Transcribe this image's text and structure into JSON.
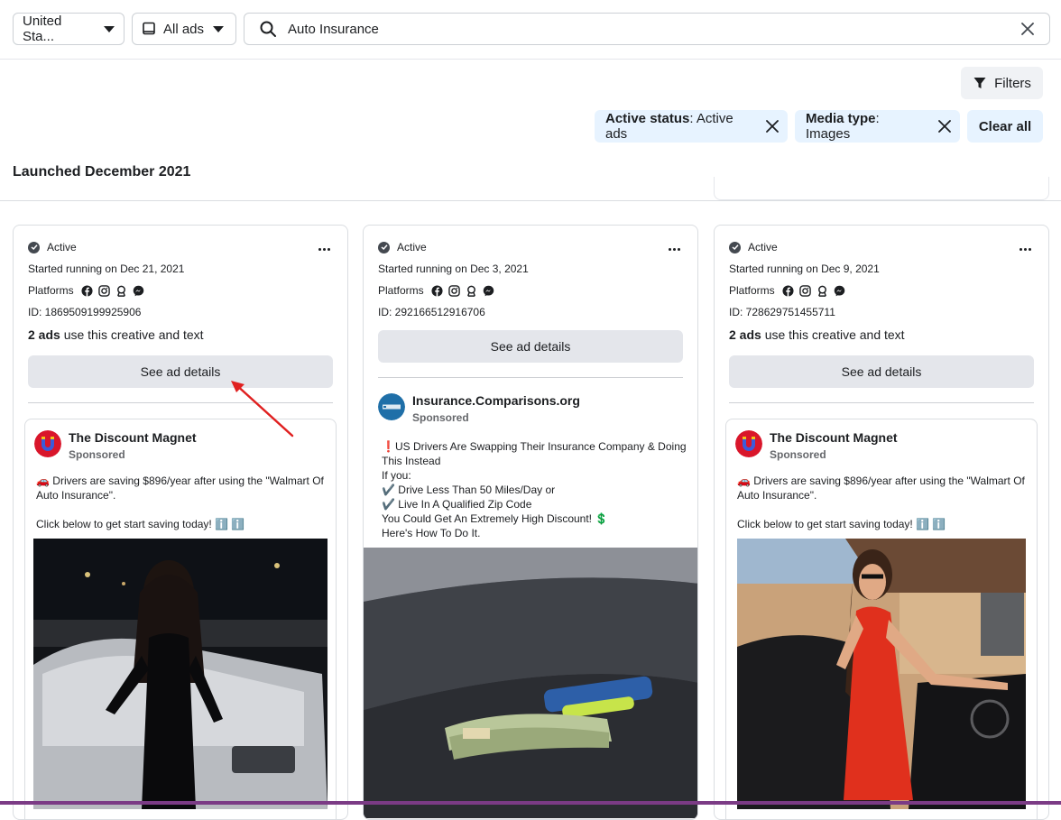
{
  "search_bar": {
    "country": "United Sta...",
    "ad_type": "All ads",
    "query": "Auto Insurance"
  },
  "filters_button": "Filters",
  "chips": [
    {
      "key": "Active status",
      "value": ": Active ads"
    },
    {
      "key": "Media type",
      "value": ": Images"
    }
  ],
  "clear_all": "Clear all",
  "section_title": "Launched December 2021",
  "cards": [
    {
      "status": "Active",
      "started": "Started running on Dec 21, 2021",
      "platforms_label": "Platforms",
      "id": "ID: 1869509199925906",
      "ads_count_bold": "2 ads",
      "ads_count_rest": " use this creative and text",
      "see_details": "See ad details",
      "advertiser": "The Discount Magnet",
      "sponsored": "Sponsored",
      "body": "🚗 Drivers are saving $896/year after using the \"Walmart Of Auto Insurance\".\n\nClick below to get start saving today! ℹ️ ℹ️"
    },
    {
      "status": "Active",
      "started": "Started running on Dec 3, 2021",
      "platforms_label": "Platforms",
      "id": "ID: 292166512916706",
      "see_details": "See ad details",
      "advertiser": "Insurance.Comparisons.org",
      "sponsored": "Sponsored",
      "body": "❗US Drivers Are Swapping Their Insurance Company & Doing This Instead\nIf you:\n✔️ Drive Less Than 50 Miles/Day or\n✔️ Live In A Qualified Zip Code\nYou Could Get An Extremely High Discount! 💲\nHere's How To Do It."
    },
    {
      "status": "Active",
      "started": "Started running on Dec 9, 2021",
      "platforms_label": "Platforms",
      "id": "ID: 728629751455711",
      "ads_count_bold": "2 ads",
      "ads_count_rest": " use this creative and text",
      "see_details": "See ad details",
      "advertiser": "The Discount Magnet",
      "sponsored": "Sponsored",
      "body": "🚗 Drivers are saving $896/year after using the \"Walmart Of Auto Insurance\".\n\nClick below to get start saving today! ℹ️ ℹ️"
    }
  ],
  "colors": {
    "chip_bg": "#e7f3ff",
    "button_gray": "#e4e6eb",
    "annotation_arrow": "#e02020"
  },
  "icons": [
    "chevron-down-icon",
    "tablet-icon",
    "search-icon",
    "close-icon",
    "filter-icon",
    "check-circle-icon",
    "more-icon",
    "facebook-icon",
    "instagram-icon",
    "audience-network-icon",
    "messenger-icon"
  ]
}
